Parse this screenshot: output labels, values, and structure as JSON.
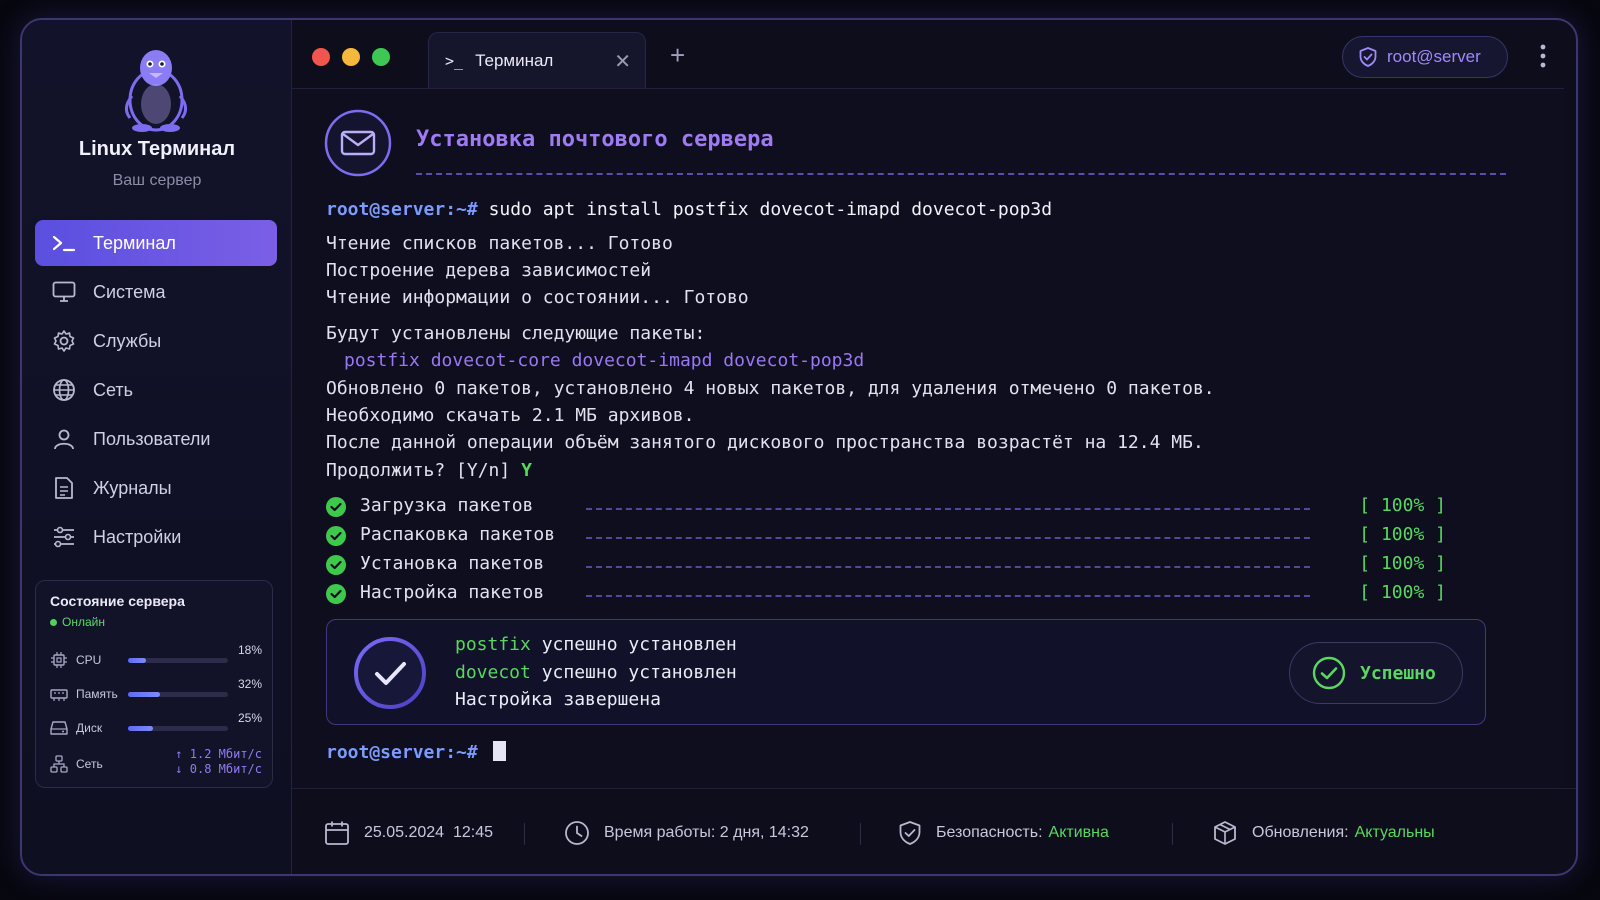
{
  "sidebar": {
    "title": "Linux Терминал",
    "subtitle": "Ваш сервер",
    "items": [
      {
        "label": "Терминал",
        "icon": "terminal-icon",
        "active": true
      },
      {
        "label": "Система",
        "icon": "monitor-icon"
      },
      {
        "label": "Службы",
        "icon": "gear-icon"
      },
      {
        "label": "Сеть",
        "icon": "globe-icon"
      },
      {
        "label": "Пользователи",
        "icon": "user-icon"
      },
      {
        "label": "Журналы",
        "icon": "document-icon"
      },
      {
        "label": "Настройки",
        "icon": "sliders-icon"
      }
    ],
    "status": {
      "title": "Состояние сервера",
      "state": "Онлайн",
      "cpu": {
        "label": "CPU",
        "value": "18%",
        "level": 0.18
      },
      "memory": {
        "label": "Память",
        "value": "32%",
        "level": 0.32
      },
      "disk": {
        "label": "Диск",
        "value": "25%",
        "level": 0.25
      },
      "network": {
        "label": "Сеть",
        "up": "↑ 1.2 Мбит/с",
        "down": "↓ 0.8 Мбит/с"
      }
    }
  },
  "tabs": {
    "active_tab": "Терминал",
    "prompt_glyph": ">_",
    "close": "✕",
    "new_tab": "+"
  },
  "user": "root@server",
  "terminal": {
    "title": "Установка почтового сервера",
    "prompt": "root@server:~#",
    "command": "sudo apt install postfix dovecot-imapd dovecot-pop3d",
    "output": [
      "Чтение списков пакетов... Готово",
      "Построение дерева зависимостей",
      "Чтение информации о состоянии... Готово"
    ],
    "install_header": "Будут установлены следующие пакеты:",
    "packages": "postfix dovecot-core dovecot-imapd dovecot-pop3d",
    "summary": [
      "Обновлено 0 пакетов, установлено 4 новых пакетов, для удаления отмечено 0 пакетов.",
      "Необходимо скачать 2.1 МБ архивов.",
      "После данной операции объём занятого дискового пространства возрастёт на 12.4 МБ."
    ],
    "confirm_question": "Продолжить? [Y/n]",
    "confirm_answer": "Y",
    "progress": [
      {
        "label": "Загрузка пакетов",
        "value": "[ 100% ]"
      },
      {
        "label": "Распаковка пакетов",
        "value": "[ 100% ]"
      },
      {
        "label": "Установка пакетов",
        "value": "[ 100% ]"
      },
      {
        "label": "Настройка пакетов",
        "value": "[ 100% ]"
      }
    ],
    "result": {
      "line1_pkg": "postfix",
      "line1_text": "успешно установлен",
      "line2_pkg": "dovecot",
      "line2_text": "успешно установлен",
      "line3": "Настройка завершена",
      "badge": "Успешно"
    },
    "final_prompt": "root@server:~#"
  },
  "statusbar": {
    "date": "25.05.2024",
    "time": "12:45",
    "uptime": "Время работы: 2 дня, 14:32",
    "security_label": "Безопасность:",
    "security_value": "Активна",
    "updates_label": "Обновления:",
    "updates_value": "Актуальны"
  },
  "colors": {
    "accent": "#6c5ce7",
    "prompt": "#7b9bff",
    "success": "#58d85e",
    "package": "#9a78f4"
  }
}
